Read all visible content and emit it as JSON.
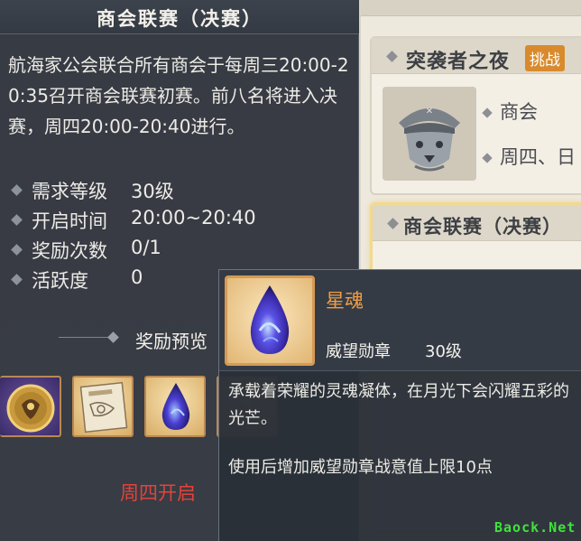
{
  "panel": {
    "title": "商会联赛（决赛）",
    "description": "航海家公会联合所有商会于每周三20:00-20:35召开商会联赛初赛。前八名将进入决赛，周四20:00-20:40进行。",
    "stats": [
      {
        "label": "需求等级",
        "value": "30级"
      },
      {
        "label": "开启时间",
        "value": "20:00~20:40"
      },
      {
        "label": "奖励次数",
        "value": "0/1"
      },
      {
        "label": "活跃度",
        "value": "0"
      }
    ],
    "reward_preview_label": "奖励预览",
    "reward_items": [
      {
        "name": "gold-medal",
        "icon": "gold-coin-icon"
      },
      {
        "name": "scroll-document",
        "icon": "scroll-icon"
      },
      {
        "name": "star-soul",
        "icon": "blue-droplet-icon"
      }
    ],
    "open_status": "周四开启",
    "colors": {
      "status": "#e0443c",
      "item_name": "#ef9e45"
    }
  },
  "activities": [
    {
      "title": "突袭者之夜",
      "tag": "挑战",
      "info": [
        "商会",
        "周四、日"
      ]
    },
    {
      "title": "商会联赛（决赛）",
      "selected": true
    }
  ],
  "tooltip": {
    "name": "星魂",
    "type": "威望勋章",
    "level": "30级",
    "description": "承载着荣耀的灵魂凝体，在月光下会闪耀五彩的光芒。",
    "usage": "使用后增加威望勋章战意值上限10点"
  },
  "watermark": "Baock.Net"
}
